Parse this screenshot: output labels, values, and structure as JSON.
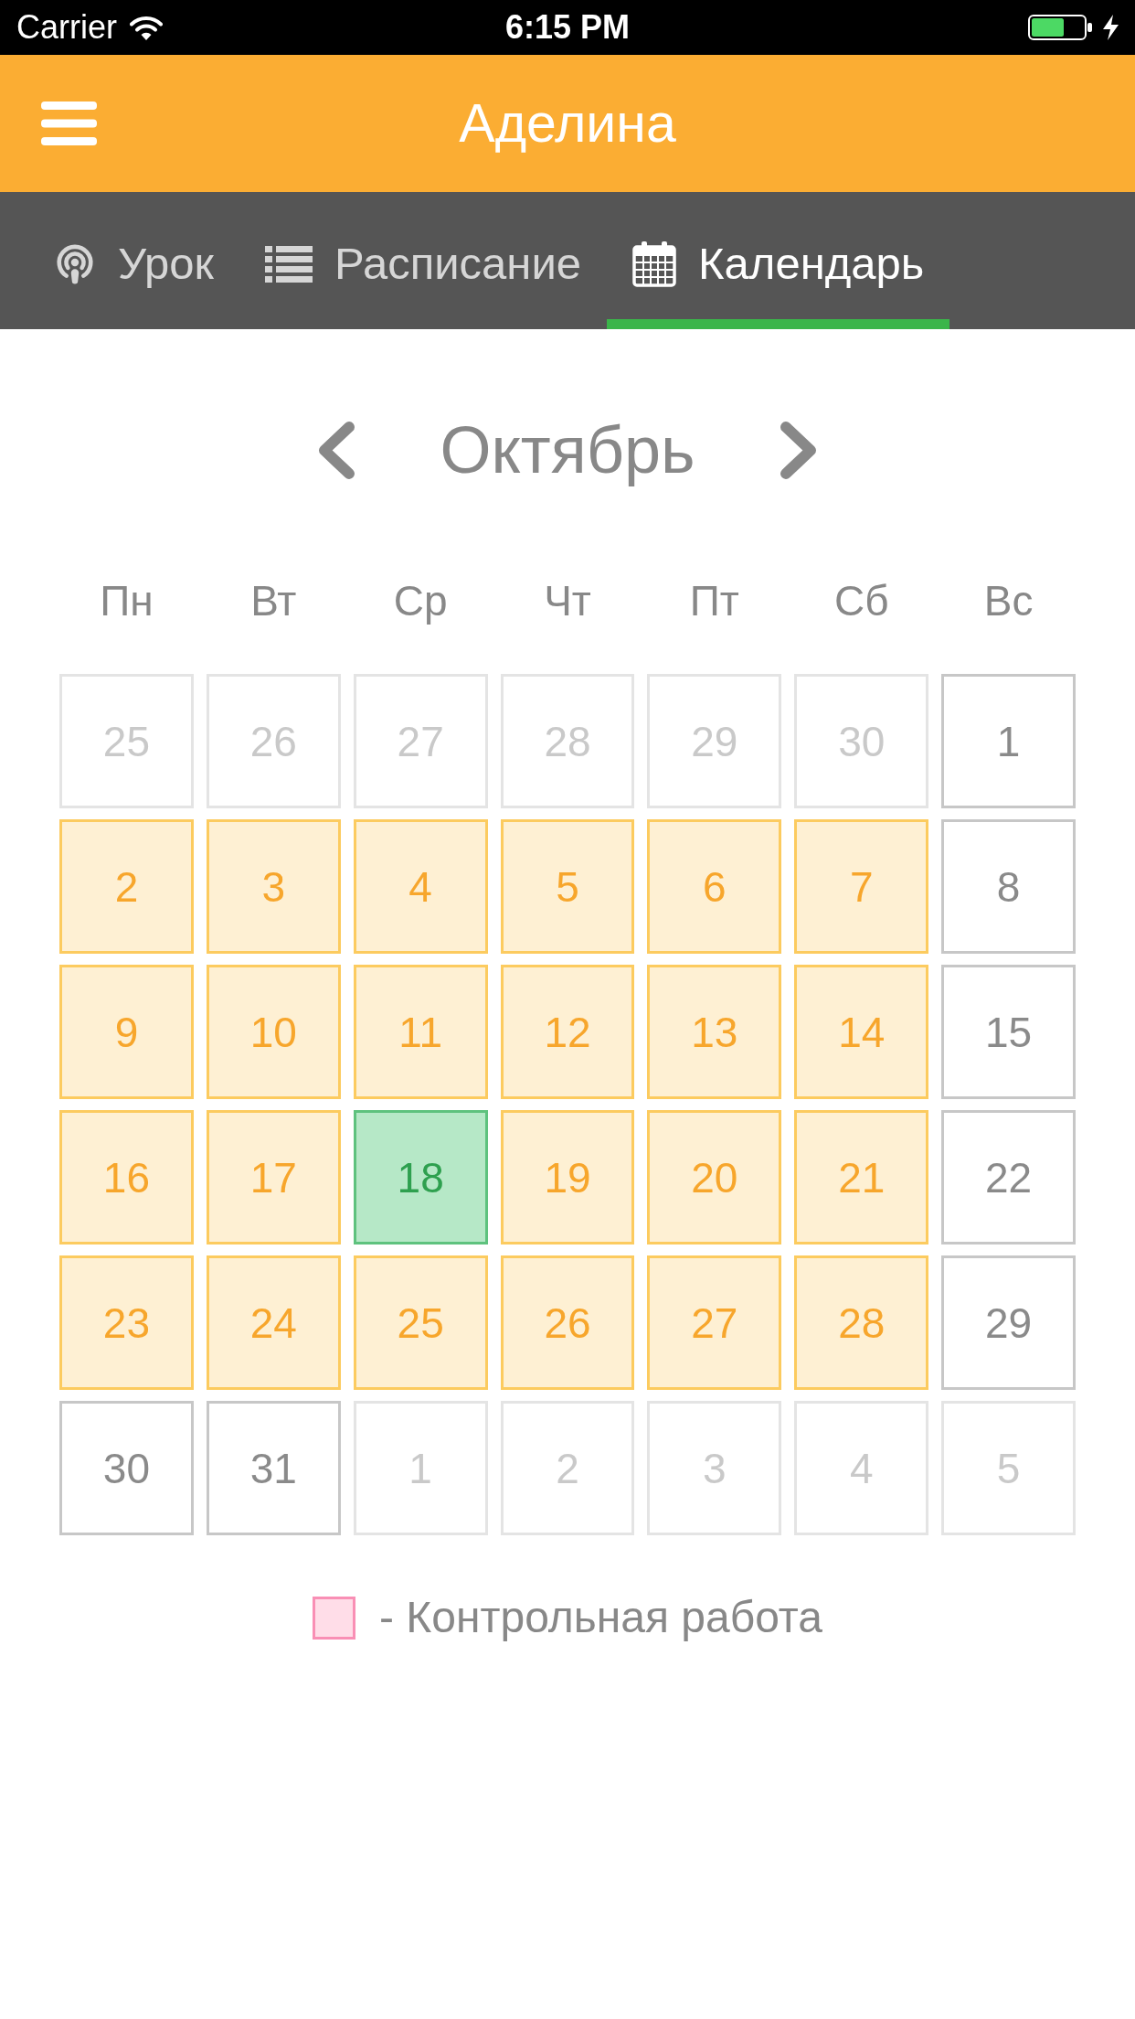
{
  "status_bar": {
    "carrier": "Carrier",
    "time": "6:15 PM"
  },
  "header": {
    "title": "Аделина"
  },
  "tabs": [
    {
      "label": "Урок",
      "selected": false
    },
    {
      "label": "Расписание",
      "selected": false
    },
    {
      "label": "Календарь",
      "selected": true
    }
  ],
  "month_nav": {
    "month": "Октябрь"
  },
  "weekdays": [
    "Пн",
    "Вт",
    "Ср",
    "Чт",
    "Пт",
    "Сб",
    "Вс"
  ],
  "days": [
    {
      "day": "25",
      "kind": "other_month"
    },
    {
      "day": "26",
      "kind": "other_month"
    },
    {
      "day": "27",
      "kind": "other_month"
    },
    {
      "day": "28",
      "kind": "other_month"
    },
    {
      "day": "29",
      "kind": "other_month"
    },
    {
      "day": "30",
      "kind": "other_month"
    },
    {
      "day": "1",
      "kind": "free"
    },
    {
      "day": "2",
      "kind": "school"
    },
    {
      "day": "3",
      "kind": "school"
    },
    {
      "day": "4",
      "kind": "school"
    },
    {
      "day": "5",
      "kind": "school"
    },
    {
      "day": "6",
      "kind": "school"
    },
    {
      "day": "7",
      "kind": "school"
    },
    {
      "day": "8",
      "kind": "free"
    },
    {
      "day": "9",
      "kind": "school"
    },
    {
      "day": "10",
      "kind": "school"
    },
    {
      "day": "11",
      "kind": "school"
    },
    {
      "day": "12",
      "kind": "school"
    },
    {
      "day": "13",
      "kind": "school"
    },
    {
      "day": "14",
      "kind": "school"
    },
    {
      "day": "15",
      "kind": "free"
    },
    {
      "day": "16",
      "kind": "school"
    },
    {
      "day": "17",
      "kind": "school"
    },
    {
      "day": "18",
      "kind": "today"
    },
    {
      "day": "19",
      "kind": "school"
    },
    {
      "day": "20",
      "kind": "school"
    },
    {
      "day": "21",
      "kind": "school"
    },
    {
      "day": "22",
      "kind": "free"
    },
    {
      "day": "23",
      "kind": "school"
    },
    {
      "day": "24",
      "kind": "school"
    },
    {
      "day": "25",
      "kind": "school"
    },
    {
      "day": "26",
      "kind": "school"
    },
    {
      "day": "27",
      "kind": "school"
    },
    {
      "day": "28",
      "kind": "school"
    },
    {
      "day": "29",
      "kind": "free"
    },
    {
      "day": "30",
      "kind": "free"
    },
    {
      "day": "31",
      "kind": "free"
    },
    {
      "day": "1",
      "kind": "other_month"
    },
    {
      "day": "2",
      "kind": "other_month"
    },
    {
      "day": "3",
      "kind": "other_month"
    },
    {
      "day": "4",
      "kind": "other_month"
    },
    {
      "day": "5",
      "kind": "other_month"
    }
  ],
  "legend": [
    {
      "label": "- Контрольная работа",
      "color": "#ffdde8"
    }
  ]
}
